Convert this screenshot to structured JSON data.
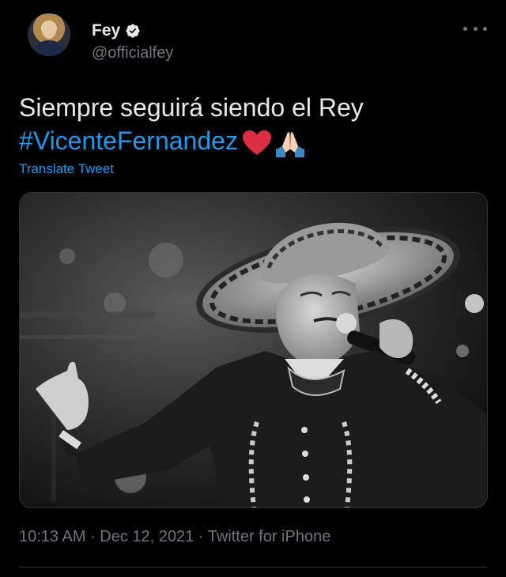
{
  "author": {
    "display_name": "Fey",
    "handle": "@officialfey",
    "verified": true
  },
  "tweet": {
    "text_line1": "Siempre seguirá siendo el Rey",
    "hashtag": "#VicenteFernandez",
    "emojis": [
      "red-heart",
      "folded-hands"
    ],
    "translate_label": "Translate Tweet",
    "media": {
      "type": "photo",
      "style": "black-and-white"
    },
    "time": "10:13 AM",
    "date": "Dec 12, 2021",
    "source": "Twitter for iPhone"
  },
  "meta_separator": " · ",
  "colors": {
    "background": "#000000",
    "text": "#e7e9ea",
    "secondary": "#71767b",
    "accent": "#1d9bf0",
    "heart": "#e0245e"
  }
}
